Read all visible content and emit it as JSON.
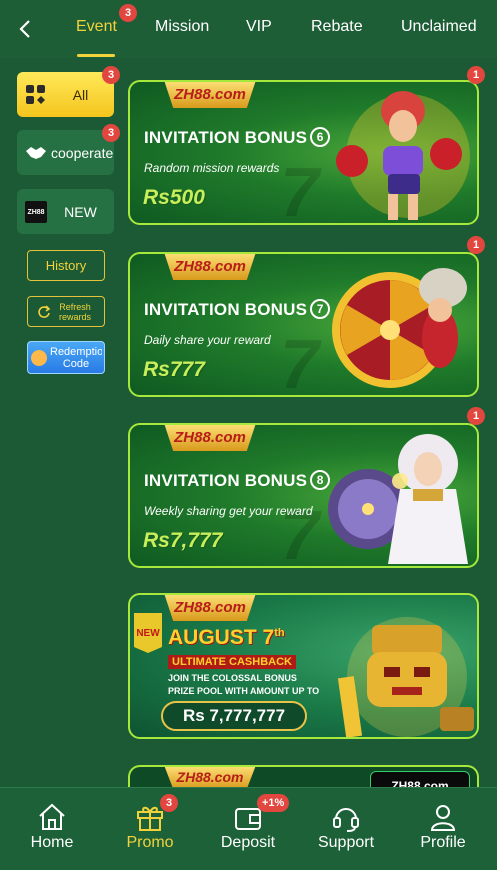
{
  "topnav": {
    "tabs": [
      {
        "label": "Event",
        "badge": "3",
        "active": true
      },
      {
        "label": "Mission"
      },
      {
        "label": "VIP"
      },
      {
        "label": "Rebate"
      },
      {
        "label": "Unclaimed"
      }
    ]
  },
  "sidebar": {
    "categories": [
      {
        "label": "All",
        "badge": "3",
        "icon": "grid-icon",
        "active": true
      },
      {
        "label": "cooperate",
        "badge": "3",
        "icon": "handshake-icon"
      },
      {
        "label": "NEW",
        "icon": "zh88-logo-icon"
      }
    ],
    "history": "History",
    "refresh": "Refresh rewards",
    "redeem": "Redemption Code"
  },
  "banners": [
    {
      "logo": "ZH88.com",
      "title": "INVITATION BONUS",
      "number": "6",
      "subtitle": "Random mission rewards",
      "amount": "Rs500",
      "badge": "1"
    },
    {
      "logo": "ZH88.com",
      "title": "INVITATION BONUS",
      "number": "7",
      "subtitle": "Daily share your reward",
      "amount": "Rs777",
      "badge": "1"
    },
    {
      "logo": "ZH88.com",
      "title": "INVITATION BONUS",
      "number": "8",
      "subtitle": "Weekly sharing get your reward",
      "amount": "Rs7,777",
      "badge": "1"
    }
  ],
  "promo": {
    "logo": "ZH88.com",
    "new_tag": "NEW",
    "title": "AUGUST 7",
    "title_sup": "th",
    "subtitle": "ULTIMATE CASHBACK",
    "line1": "JOIN THE COLOSSAL BONUS",
    "line2": "PRIZE POOL WITH AMOUNT UP TO",
    "amount": "Rs 7,777,777"
  },
  "partial_banner": {
    "logo": "ZH88.com",
    "mini_logo": "ZH88.com"
  },
  "bottomnav": {
    "items": [
      {
        "label": "Home",
        "icon": "home-icon"
      },
      {
        "label": "Promo",
        "icon": "gift-icon",
        "badge": "3",
        "active": true
      },
      {
        "label": "Deposit",
        "icon": "wallet-icon",
        "badge": "+1%"
      },
      {
        "label": "Support",
        "icon": "headset-icon"
      },
      {
        "label": "Profile",
        "icon": "person-icon"
      }
    ]
  },
  "colors": {
    "accent": "#f2d23c",
    "background": "#1b5a34",
    "badge": "#e1463f",
    "banner_border": "#a6e83c"
  }
}
